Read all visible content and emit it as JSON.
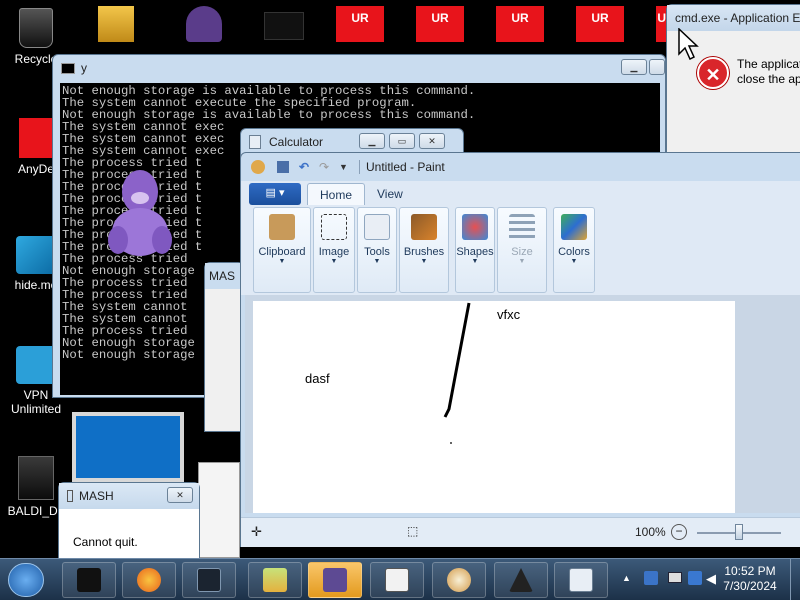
{
  "desktop_icons": [
    {
      "label": "Recycle"
    },
    {
      "label": "AnyDe"
    },
    {
      "label": "hide.me"
    },
    {
      "label": "VPN"
    },
    {
      "label": "Unlimited"
    },
    {
      "label": "BALDI_Da"
    }
  ],
  "ur_boxes": [
    "UR",
    "UR",
    "UR",
    "UR",
    "UR"
  ],
  "cmd_window": {
    "title": "y",
    "lines": [
      "Not enough storage is available to process this command.",
      "The system cannot execute the specified program.",
      "Not enough storage is available to process this command.",
      "The system cannot exec",
      "The system cannot exec",
      "The system cannot exec",
      "The process tried t",
      "The process tried t",
      "The process tried t",
      "The process tried t",
      "The process tried t",
      "The process tried t",
      "The process tried t",
      "The process tried t",
      "The process tried",
      "Not enough storage",
      "The process tried",
      "The process tried",
      "The system cannot",
      "The system cannot",
      "The process tried",
      "Not enough storage",
      "Not enough storage"
    ]
  },
  "calculator": {
    "title": "Calculator"
  },
  "mash_behind": {
    "title": "MAS"
  },
  "mash_dialog": {
    "title": "MASH",
    "message": "Cannot quit."
  },
  "error_dialog": {
    "title": "cmd.exe - Application E",
    "message_line1": "The applicat",
    "message_line2": "close the ap"
  },
  "paint": {
    "title": "Untitled - Paint",
    "tabs": [
      "Home",
      "View"
    ],
    "groups": [
      {
        "label": "Clipboard"
      },
      {
        "label": "Image"
      },
      {
        "label": "Tools"
      },
      {
        "label": "Brushes"
      },
      {
        "label": "Shapes"
      },
      {
        "label": "Size"
      },
      {
        "label": "Colors"
      }
    ],
    "canvas_text_1": "vfxc",
    "canvas_text_2": "dasf",
    "zoom": "100%"
  },
  "clock": {
    "time": "10:52 PM",
    "date": "7/30/2024"
  },
  "colors": {
    "ur_red": "#e8141b",
    "taskbar": "#1c3148",
    "error_red": "#d9262b"
  }
}
